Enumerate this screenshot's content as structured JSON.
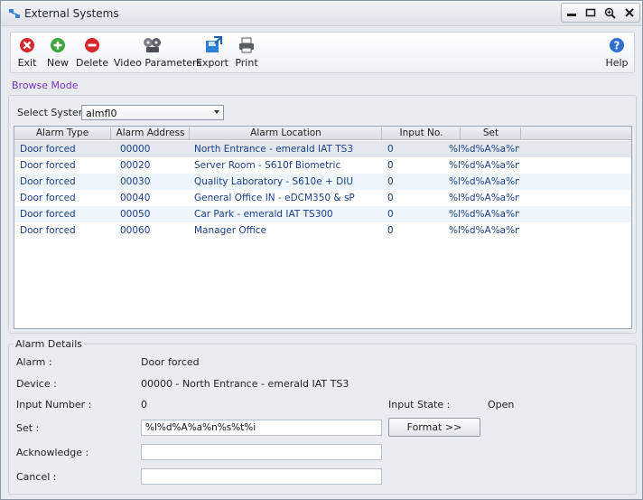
{
  "window": {
    "title": "External Systems",
    "controls": [
      "minimize-icon",
      "restore-icon",
      "zoom-icon",
      "close-icon"
    ]
  },
  "toolbar": {
    "exit_label": "Exit",
    "new_label": "New",
    "delete_label": "Delete",
    "video_label": "Video Parameters",
    "export_label": "Export",
    "print_label": "Print",
    "help_label": "Help"
  },
  "mode": "Browse Mode",
  "system": {
    "label": "Select System",
    "value": "almfl0"
  },
  "grid": {
    "columns": [
      "Alarm Type",
      "Alarm Address",
      "Alarm Location",
      "Input No.",
      "Set"
    ],
    "rows": [
      {
        "type": "Door forced",
        "address": "00000",
        "location": "North Entrance - emerald IAT TS3",
        "input": "0",
        "set": "%l%d%A%a%n%"
      },
      {
        "type": "Door forced",
        "address": "00020",
        "location": "Server Room - S610f Biometric",
        "input": "0",
        "set": "%l%d%A%a%n%"
      },
      {
        "type": "Door forced",
        "address": "00030",
        "location": "Quality Laboratory - S610e + DIU",
        "input": "0",
        "set": "%l%d%A%a%n%"
      },
      {
        "type": "Door forced",
        "address": "00040",
        "location": "General Office IN - eDCM350 & sP",
        "input": "0",
        "set": "%l%d%A%a%n%"
      },
      {
        "type": "Door forced",
        "address": "00050",
        "location": "Car Park - emerald IAT TS300",
        "input": "0",
        "set": "%l%d%A%a%n%"
      },
      {
        "type": "Door forced",
        "address": "00060",
        "location": "Manager Office",
        "input": "0",
        "set": "%l%d%A%a%n%"
      }
    ]
  },
  "details": {
    "legend": "Alarm Details",
    "alarm_label": "Alarm :",
    "alarm_value": "Door forced",
    "device_label": "Device :",
    "device_value": "00000 - North Entrance - emerald IAT TS3",
    "input_number_label": "Input Number :",
    "input_number_value": "0",
    "input_state_label": "Input State :",
    "input_state_value": "Open",
    "set_label": "Set :",
    "set_value": "%l%d%A%a%n%s%t%i",
    "format_label": "Format >>",
    "acknowledge_label": "Acknowledge :",
    "acknowledge_value": "",
    "cancel_label": "Cancel :",
    "cancel_value": ""
  },
  "colors": {
    "mode_text": "#7a2fc4",
    "grid_text": "#1b3f8a",
    "exit": "#d6282b",
    "new": "#3aa83a",
    "delete": "#d6282b",
    "help": "#2f6fd1"
  }
}
